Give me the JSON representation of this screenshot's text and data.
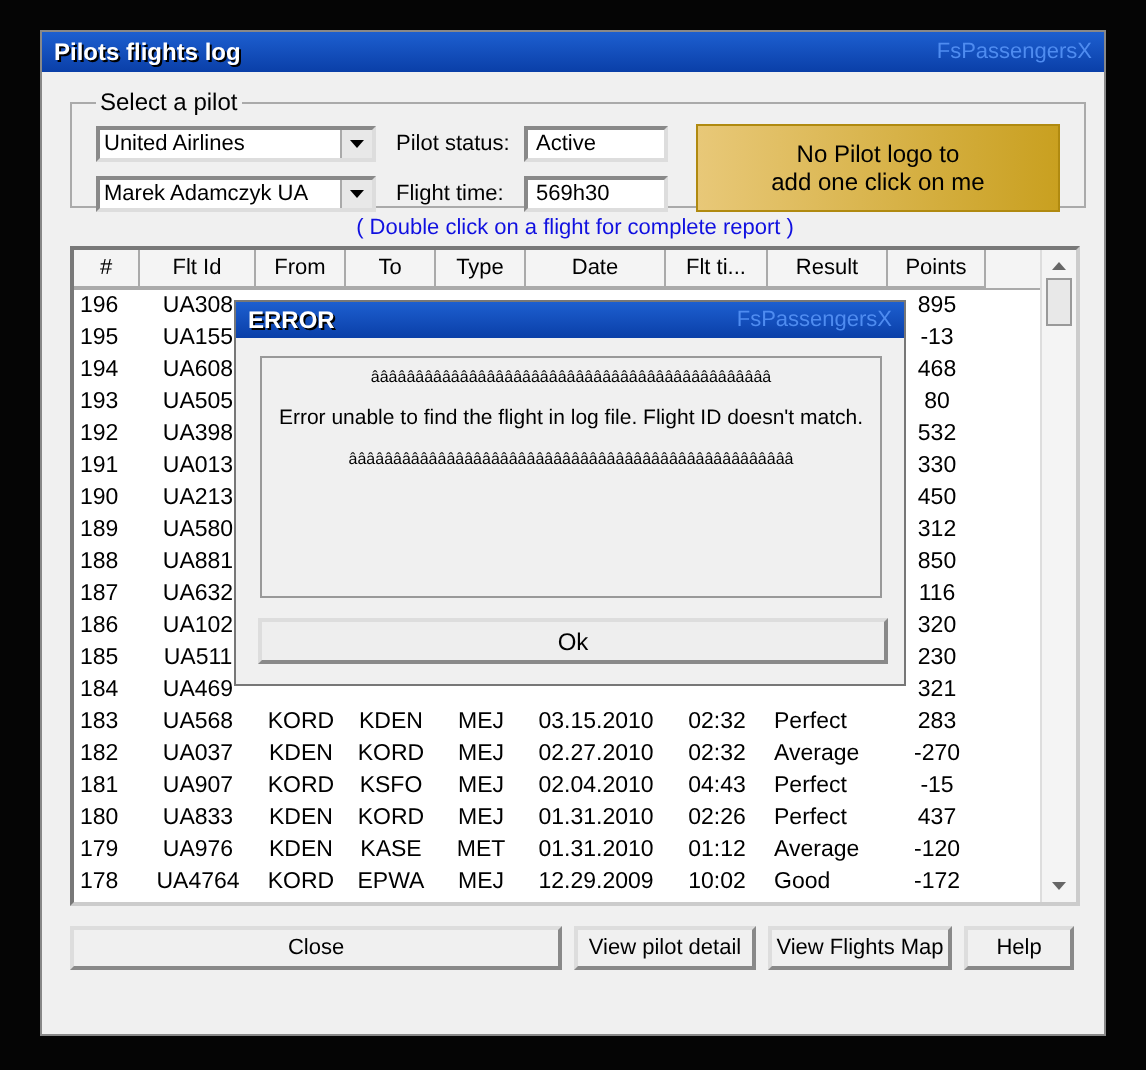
{
  "window": {
    "title": "Pilots flights log",
    "brand": "FsPassengersX"
  },
  "pilot_group": {
    "legend": "Select a pilot",
    "airline": "United Airlines",
    "pilot": "Marek Adamczyk UA",
    "status_label": "Pilot status:",
    "status": "Active",
    "time_label": "Flight time:",
    "time": "569h30",
    "logo_button": [
      "No Pilot logo to",
      "add one click on me"
    ]
  },
  "hint": "( Double click on a flight for complete report )",
  "table": {
    "columns": [
      "#",
      "Flt Id",
      "From",
      "To",
      "Type",
      "Date",
      "Flt ti...",
      "Result",
      "Points"
    ],
    "rows": [
      {
        "cells": [
          "196",
          "UA308",
          null,
          null,
          null,
          null,
          null,
          null,
          "895"
        ]
      },
      {
        "cells": [
          "195",
          "UA155",
          null,
          null,
          null,
          null,
          null,
          null,
          "-13"
        ]
      },
      {
        "cells": [
          "194",
          "UA608",
          null,
          null,
          null,
          null,
          null,
          null,
          "468"
        ]
      },
      {
        "cells": [
          "193",
          "UA505",
          null,
          null,
          null,
          null,
          null,
          null,
          "80"
        ]
      },
      {
        "cells": [
          "192",
          "UA398",
          null,
          null,
          null,
          null,
          null,
          null,
          "532"
        ]
      },
      {
        "cells": [
          "191",
          "UA013",
          null,
          null,
          null,
          null,
          null,
          null,
          "330"
        ]
      },
      {
        "cells": [
          "190",
          "UA213",
          null,
          null,
          null,
          null,
          null,
          null,
          "450"
        ]
      },
      {
        "cells": [
          "189",
          "UA580",
          null,
          null,
          null,
          null,
          null,
          null,
          "312"
        ]
      },
      {
        "cells": [
          "188",
          "UA881",
          null,
          null,
          null,
          null,
          null,
          null,
          "850"
        ]
      },
      {
        "cells": [
          "187",
          "UA632",
          null,
          null,
          null,
          null,
          null,
          null,
          "116"
        ]
      },
      {
        "cells": [
          "186",
          "UA102",
          null,
          null,
          null,
          null,
          null,
          null,
          "320"
        ]
      },
      {
        "cells": [
          "185",
          "UA511",
          null,
          null,
          null,
          null,
          null,
          null,
          "230"
        ]
      },
      {
        "cells": [
          "184",
          "UA469",
          null,
          null,
          null,
          null,
          null,
          null,
          "321"
        ]
      },
      {
        "cells": [
          "183",
          "UA568",
          "KORD",
          "KDEN",
          "MEJ",
          "03.15.2010",
          "02:32",
          "Perfect",
          "283"
        ]
      },
      {
        "cells": [
          "182",
          "UA037",
          "KDEN",
          "KORD",
          "MEJ",
          "02.27.2010",
          "02:32",
          "Average",
          "-270"
        ]
      },
      {
        "cells": [
          "181",
          "UA907",
          "KORD",
          "KSFO",
          "MEJ",
          "02.04.2010",
          "04:43",
          "Perfect",
          "-15"
        ]
      },
      {
        "cells": [
          "180",
          "UA833",
          "KDEN",
          "KORD",
          "MEJ",
          "01.31.2010",
          "02:26",
          "Perfect",
          "437"
        ]
      },
      {
        "cells": [
          "179",
          "UA976",
          "KDEN",
          "KASE",
          "MET",
          "01.31.2010",
          "01:12",
          "Average",
          "-120"
        ]
      },
      {
        "cells": [
          "178",
          "UA4764",
          "KORD",
          "EPWA",
          "MEJ",
          "12.29.2009",
          "10:02",
          "Good",
          "-172"
        ]
      }
    ]
  },
  "buttons": [
    "Close",
    "View pilot detail",
    "View Flights Map",
    "Help"
  ],
  "dialog": {
    "title": "ERROR",
    "brand": "FsPassengersX",
    "lines": [
      "âââââââââââââââââââââââââââââââââââââââââââââ",
      "Error unable to find the flight in log file. Flight ID doesn't match.",
      "ââââââââââââââââââââââââââââââââââââââââââââââââââ"
    ],
    "button": "Ok"
  }
}
